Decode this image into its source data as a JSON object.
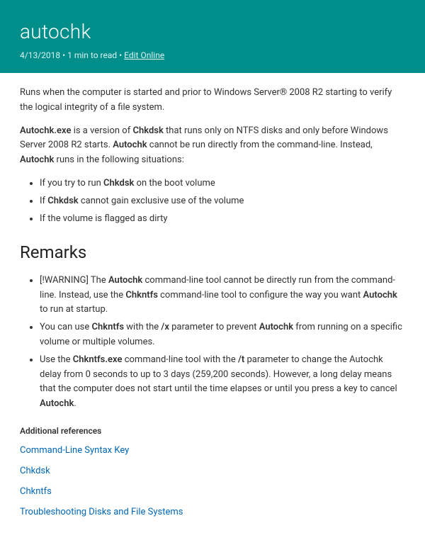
{
  "header": {
    "title": "autochk",
    "date": "4/13/2018",
    "read_time": "1 min to read",
    "edit_link": "Edit Online"
  },
  "intro": {
    "p1_a": "Runs when the computer is started and prior to Windows Server® 2008 R2 starting to verify the logical integrity of a file system.",
    "p2_a": "Autochk.exe",
    "p2_b": " is a version of ",
    "p2_c": "Chkdsk",
    "p2_d": " that runs only on NTFS disks and only before Windows Server 2008 R2 starts. ",
    "p2_e": "Autochk",
    "p2_f": " cannot be run directly from the command-line. Instead, ",
    "p2_g": "Autochk",
    "p2_h": " runs in the following situations:"
  },
  "situations": {
    "s1_a": "If you try to run ",
    "s1_b": "Chkdsk",
    "s1_c": " on the boot volume",
    "s2_a": "If ",
    "s2_b": "Chkdsk",
    "s2_c": " cannot gain exclusive use of the volume",
    "s3": "If the volume is flagged as dirty"
  },
  "remarks_heading": "Remarks",
  "remarks": {
    "r1_a": "[!WARNING] The ",
    "r1_b": "Autochk",
    "r1_c": " command-line tool cannot be directly run from the command-line. Instead, use the ",
    "r1_d": "Chkntfs",
    "r1_e": " command-line tool to configure the way you want ",
    "r1_f": "Autochk",
    "r1_g": " to run at startup.",
    "r2_a": "You can use ",
    "r2_b": "Chkntfs",
    "r2_c": " with the ",
    "r2_d": "/x",
    "r2_e": " parameter to prevent ",
    "r2_f": "Autochk",
    "r2_g": " from running on a specific volume or multiple volumes.",
    "r3_a": "Use the ",
    "r3_b": "Chkntfs.exe",
    "r3_c": " command-line tool with the ",
    "r3_d": "/t",
    "r3_e": " parameter to change the Autochk delay from 0 seconds to up to 3 days (259,200 seconds). However, a long delay means that the computer does not start until the time elapses or until you press a key to cancel ",
    "r3_f": "Autochk",
    "r3_g": "."
  },
  "refs_heading": "Additional references",
  "refs": {
    "l1": "Command-Line Syntax Key",
    "l2": "Chkdsk",
    "l3": "Chkntfs",
    "l4": "Troubleshooting Disks and File Systems"
  }
}
